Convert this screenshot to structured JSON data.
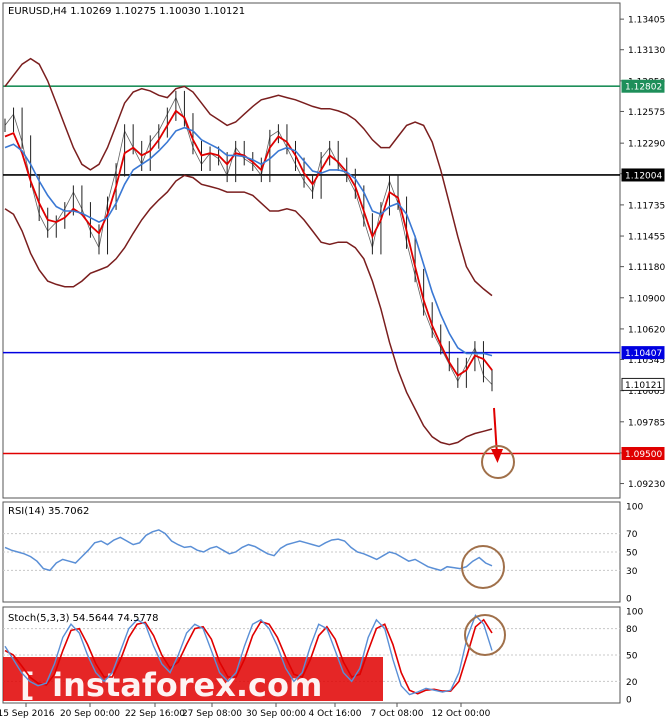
{
  "header": {
    "main_label": "EURUSD,H4  1.10269 1.10275 1.10030 1.10121",
    "rsi_label": "RSI(14) 35.7062",
    "stoch_label": "Stoch(5,3,3) 54.5644 74.5778"
  },
  "watermark": "instaforex.com",
  "colors": {
    "price": "#1e1e1e",
    "upper_lower_band": "#7a1e1e",
    "ma_fast": "#e00000",
    "ma_slow": "#3a78d4",
    "green_level": "#1e8f5a",
    "black_level": "#000000",
    "blue_level": "#0000e0",
    "red_level": "#e00000",
    "circle": "#a0704a",
    "oscillator": "#5a8fd6",
    "stoch_signal": "#e00000",
    "watermark_bar": "#e00000"
  },
  "chart_data": [
    {
      "type": "line",
      "panel": "price",
      "title": "EURUSD,H4  1.10269 1.10275 1.10030 1.10121",
      "ylim": [
        1.091,
        1.1355
      ],
      "y_ticks": [
        "1.13405",
        "1.13130",
        "1.12850",
        "1.12575",
        "1.12290",
        "1.12015",
        "1.11735",
        "1.11455",
        "1.11180",
        "1.10900",
        "1.10620",
        "1.10345",
        "1.10065",
        "1.09785",
        "1.09505",
        "1.09230"
      ],
      "horizontal_levels": [
        {
          "label": "1.12802",
          "value": 1.12802,
          "color": "#1e8f5a"
        },
        {
          "label": "1.12004",
          "value": 1.12004,
          "color": "#000000"
        },
        {
          "label": "1.10407",
          "value": 1.10407,
          "color": "#0000e0"
        },
        {
          "label": "1.10121",
          "value": 1.10121,
          "color": "#1e1e1e"
        },
        {
          "label": "1.09500",
          "value": 1.095,
          "color": "#e00000"
        }
      ],
      "x_ticks": [
        "15 Sep 2016",
        "20 Sep 00:00",
        "22 Sep 16:00",
        "27 Sep 08:00",
        "30 Sep 00:00",
        "4 Oct 16:00",
        "7 Oct 08:00",
        "12 Oct 00:00"
      ],
      "series": [
        {
          "id": "price",
          "values": [
            1.1245,
            1.1255,
            1.123,
            1.1195,
            1.1165,
            1.115,
            1.1158,
            1.117,
            1.1185,
            1.117,
            1.115,
            1.1135,
            1.1175,
            1.1205,
            1.124,
            1.1225,
            1.121,
            1.123,
            1.124,
            1.1255,
            1.127,
            1.125,
            1.1225,
            1.121,
            1.122,
            1.1215,
            1.12,
            1.1225,
            1.1215,
            1.121,
            1.12,
            1.1235,
            1.124,
            1.1225,
            1.121,
            1.1195,
            1.1185,
            1.1215,
            1.1225,
            1.121,
            1.12,
            1.1185,
            1.116,
            1.1135,
            1.117,
            1.1195,
            1.1175,
            1.114,
            1.111,
            1.108,
            1.106,
            1.1045,
            1.103,
            1.1015,
            1.103,
            1.1045,
            1.102,
            1.1012
          ]
        },
        {
          "id": "ma_fast",
          "values": [
            1.1235,
            1.1238,
            1.122,
            1.1195,
            1.1175,
            1.116,
            1.1158,
            1.1162,
            1.117,
            1.1165,
            1.1155,
            1.1148,
            1.1165,
            1.119,
            1.122,
            1.1225,
            1.1218,
            1.1222,
            1.1232,
            1.1245,
            1.1258,
            1.1252,
            1.1232,
            1.1218,
            1.122,
            1.1218,
            1.121,
            1.122,
            1.1218,
            1.1212,
            1.1205,
            1.1225,
            1.1235,
            1.123,
            1.1218,
            1.1202,
            1.1192,
            1.1205,
            1.1218,
            1.1212,
            1.1203,
            1.119,
            1.1168,
            1.1145,
            1.116,
            1.1185,
            1.118,
            1.115,
            1.1118,
            1.1088,
            1.1065,
            1.1048,
            1.1032,
            1.102,
            1.1025,
            1.1038,
            1.1035,
            1.1025
          ]
        },
        {
          "id": "ma_slow",
          "values": [
            1.1225,
            1.1228,
            1.1222,
            1.121,
            1.1195,
            1.1182,
            1.1172,
            1.1168,
            1.1168,
            1.1166,
            1.1162,
            1.1158,
            1.1162,
            1.1175,
            1.1192,
            1.1205,
            1.121,
            1.1215,
            1.1222,
            1.123,
            1.124,
            1.1243,
            1.124,
            1.1232,
            1.1228,
            1.1224,
            1.1218,
            1.1218,
            1.1217,
            1.1214,
            1.121,
            1.1215,
            1.1222,
            1.1225,
            1.1222,
            1.1213,
            1.1204,
            1.1202,
            1.1205,
            1.1205,
            1.1203,
            1.1197,
            1.1185,
            1.1168,
            1.1165,
            1.1172,
            1.1175,
            1.1165,
            1.1145,
            1.112,
            1.1095,
            1.1075,
            1.1058,
            1.1045,
            1.104,
            1.104,
            1.104,
            1.1038
          ]
        },
        {
          "id": "upper_band",
          "values": [
            1.128,
            1.129,
            1.13,
            1.1305,
            1.13,
            1.1285,
            1.1265,
            1.1245,
            1.1225,
            1.121,
            1.1205,
            1.121,
            1.1225,
            1.1245,
            1.1265,
            1.1275,
            1.1278,
            1.1276,
            1.1272,
            1.127,
            1.1278,
            1.128,
            1.1275,
            1.1265,
            1.1255,
            1.125,
            1.1245,
            1.1248,
            1.1255,
            1.1262,
            1.1268,
            1.127,
            1.1272,
            1.127,
            1.1268,
            1.1265,
            1.1262,
            1.126,
            1.126,
            1.1258,
            1.1255,
            1.125,
            1.1242,
            1.1232,
            1.1225,
            1.1225,
            1.1235,
            1.1245,
            1.1248,
            1.1245,
            1.123,
            1.1205,
            1.1175,
            1.1145,
            1.1118,
            1.1105,
            1.1098,
            1.1092
          ]
        },
        {
          "id": "lower_band",
          "values": [
            1.117,
            1.1165,
            1.115,
            1.113,
            1.1115,
            1.1105,
            1.1102,
            1.11,
            1.11,
            1.1105,
            1.1112,
            1.1115,
            1.1118,
            1.1125,
            1.1135,
            1.1148,
            1.116,
            1.117,
            1.1178,
            1.1185,
            1.1195,
            1.12,
            1.1198,
            1.1192,
            1.119,
            1.1188,
            1.1185,
            1.1185,
            1.1185,
            1.1182,
            1.1175,
            1.1168,
            1.1168,
            1.117,
            1.1168,
            1.116,
            1.115,
            1.114,
            1.1138,
            1.114,
            1.114,
            1.1135,
            1.1125,
            1.1105,
            1.108,
            1.105,
            1.1025,
            1.1005,
            1.099,
            1.0975,
            1.0965,
            1.096,
            1.0958,
            1.096,
            1.0965,
            1.0968,
            1.097,
            1.0972
          ]
        }
      ]
    },
    {
      "type": "line",
      "panel": "rsi",
      "title": "RSI(14) 35.7062",
      "ylim": [
        0,
        100
      ],
      "y_ticks": [
        "100",
        "70",
        "50",
        "30",
        "0"
      ],
      "series": [
        {
          "id": "rsi",
          "values": [
            55,
            52,
            50,
            48,
            45,
            40,
            32,
            30,
            38,
            42,
            40,
            38,
            45,
            52,
            60,
            62,
            58,
            63,
            66,
            62,
            58,
            60,
            68,
            72,
            74,
            70,
            62,
            58,
            55,
            56,
            52,
            50,
            54,
            56,
            52,
            48,
            50,
            55,
            58,
            56,
            52,
            48,
            46,
            54,
            58,
            60,
            62,
            60,
            58,
            56,
            60,
            63,
            64,
            62,
            55,
            50,
            48,
            45,
            42,
            46,
            50,
            48,
            44,
            40,
            42,
            38,
            34,
            32,
            30,
            34,
            33,
            32,
            34,
            40,
            44,
            38,
            35
          ]
        }
      ]
    },
    {
      "type": "line",
      "panel": "stochastic",
      "title": "Stoch(5,3,3) 54.5644 74.5778",
      "ylim": [
        0,
        100
      ],
      "y_ticks": [
        "100",
        "80",
        "50",
        "20",
        "0"
      ],
      "series": [
        {
          "id": "stoch_main",
          "values": [
            60,
            45,
            30,
            20,
            15,
            18,
            40,
            70,
            85,
            75,
            50,
            30,
            20,
            30,
            55,
            80,
            90,
            85,
            60,
            40,
            30,
            50,
            75,
            85,
            80,
            55,
            30,
            20,
            30,
            60,
            85,
            90,
            80,
            60,
            35,
            20,
            30,
            60,
            85,
            80,
            55,
            30,
            20,
            35,
            70,
            90,
            80,
            45,
            15,
            5,
            8,
            12,
            10,
            8,
            10,
            30,
            70,
            95,
            85,
            55
          ]
        },
        {
          "id": "stoch_signal",
          "values": [
            55,
            50,
            38,
            25,
            18,
            16,
            28,
            55,
            78,
            80,
            62,
            40,
            25,
            25,
            45,
            70,
            85,
            87,
            72,
            50,
            35,
            42,
            62,
            80,
            82,
            68,
            42,
            25,
            25,
            45,
            72,
            88,
            85,
            70,
            48,
            28,
            25,
            45,
            72,
            82,
            68,
            42,
            25,
            28,
            55,
            80,
            85,
            62,
            30,
            10,
            6,
            10,
            11,
            9,
            9,
            20,
            50,
            82,
            90,
            75
          ]
        }
      ]
    }
  ]
}
